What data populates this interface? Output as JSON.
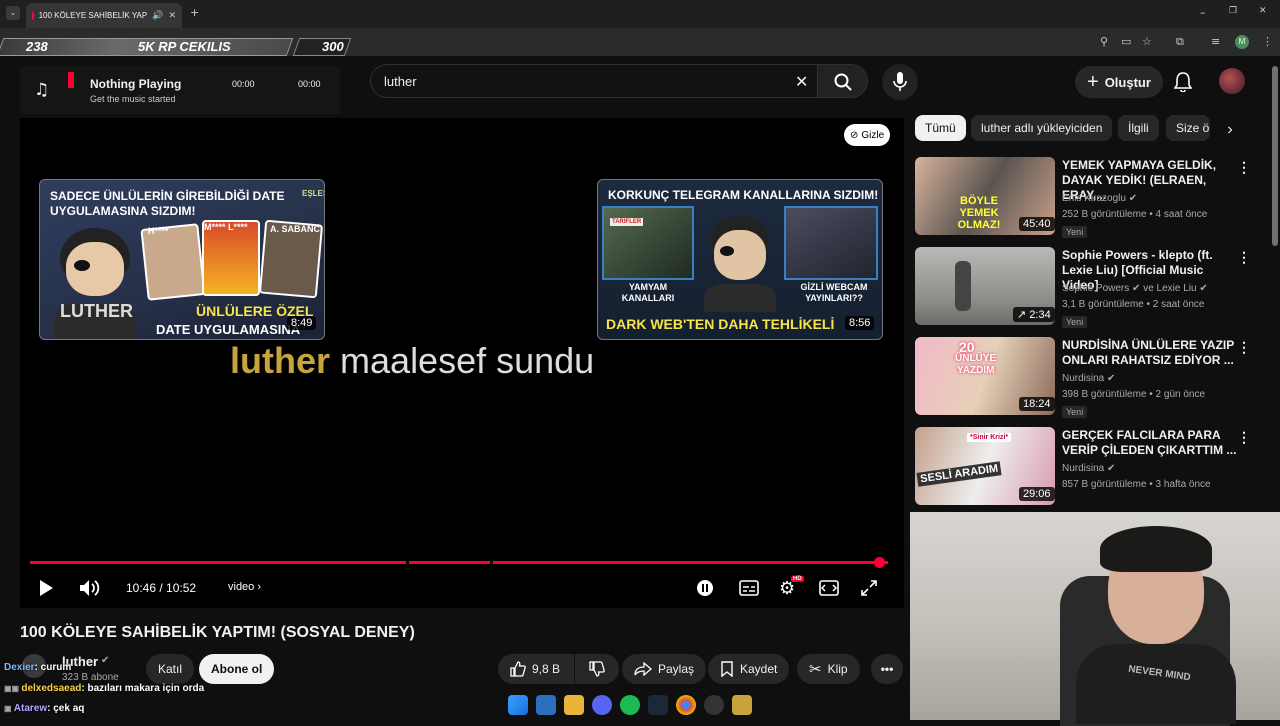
{
  "browser": {
    "tab_title": "100 KÖLEYE SAHİBELİK YAP",
    "new_tab": "+",
    "win_min": "–",
    "win_max": "❐",
    "win_close": "✕"
  },
  "overlay": {
    "left": "238",
    "center": "5K RP CEKILIS",
    "right": "300"
  },
  "music": {
    "title": "Nothing Playing",
    "subtitle": "Get the music started",
    "time_current": "00:00",
    "time_total": "00:00"
  },
  "search": {
    "value": "luther"
  },
  "header": {
    "create_label": "Oluştur"
  },
  "player": {
    "hide_label": "Gizle",
    "endscreen_text_a": "luther",
    "endscreen_text_b": "maalesef sundu",
    "card1": {
      "title_line1": "SADECE ÜNLÜLERİN GİREBİLDİĞİ DATE",
      "title_line2": "UYGULAMASINA SIZDIM!",
      "tag": "EŞLEŞTİN!",
      "name1": "H****",
      "name2": "M**** L****",
      "name3": "A. SABANCI",
      "brand": "LUTHER",
      "bottom1": "ÜNLÜLERE ÖZEL",
      "bottom2": "DATE UYGULAMASINA SIZDIM!",
      "duration": "8:49"
    },
    "card2": {
      "title": "KORKUNÇ TELEGRAM KANALLARINA SIZDIM!",
      "panel1": "TARİFLER",
      "label1": "YAMYAM KANALLARI",
      "label2": "GİZLİ WEBCAM YAYINLARI??",
      "bottom": "DARK WEB'TEN DAHA TEHLİKELİ",
      "duration": "8:56"
    },
    "time": "10:46 / 10:52",
    "chapter": "video",
    "progress_fraction": 0.99,
    "hd_badge": "HD"
  },
  "video": {
    "title": "100 KÖLEYE SAHİBELİK YAPTIM! (SOSYAL DENEY)",
    "channel": "luther",
    "subscribers": "323 B abone",
    "join_label": "Katıl",
    "subscribe_label": "Abone ol",
    "likes": "9,8 B",
    "share_label": "Paylaş",
    "save_label": "Kaydet",
    "clip_label": "Klip"
  },
  "chips": [
    "Tümü",
    "luther adlı yükleyiciden",
    "İlgili",
    "Size ö"
  ],
  "recommendations": [
    {
      "title": "YEMEK YAPMAYA GELDİK, DAYAK YEDİK! (ELRAEN, ERAY,...",
      "channel": "Enis Kirazoglu",
      "meta": "252 B görüntüleme • 4 saat önce",
      "badge": "Yeni",
      "duration": "45:40",
      "thumb_text": "BÖYLE YEMEK OLMAZ!"
    },
    {
      "title": "Sophie Powers - klepto (ft. Lexie Liu) [Official Music Video]",
      "channel": "Sophie Powers",
      "channel2": "ve Lexie Liu",
      "meta": "3,1 B görüntüleme • 2 saat önce",
      "badge": "Yeni",
      "duration": "2:34"
    },
    {
      "title": "NURDİSİNA ÜNLÜLERE YAZIP ONLARI RAHATSIZ EDİYOR ...",
      "channel": "Nurdisina",
      "meta": "398 B görüntüleme • 2 gün önce",
      "badge": "Yeni",
      "duration": "18:24",
      "thumb_text_1": "20",
      "thumb_text_2": "ÜNLÜYE",
      "thumb_text_3": "YAZDIM"
    },
    {
      "title": "GERÇEK FALCILARA PARA VERİP ÇİLEDEN ÇIKARTTIM ...",
      "channel": "Nurdisina",
      "meta": "857 B görüntüleme • 3 hafta önce",
      "duration": "29:06",
      "thumb_text": "SESLİ ARADIM",
      "thumb_tag": "*Sinir Krizi*"
    }
  ],
  "chat": [
    {
      "user": "Dexier",
      "message": ": curum",
      "color": "#7ab8ff"
    },
    {
      "user": "delxedsaead",
      "message": ": bazıları makara için orda",
      "color": "#ffd24a"
    },
    {
      "user": "Atarew",
      "message": ": çek aq",
      "color": "#b6a4ff"
    }
  ],
  "webcam": {
    "shirt_text": "NEVER MIND"
  },
  "colors": {
    "accent": "#ff0033",
    "gold": "#c8a23a",
    "bg": "#0f0f0f"
  }
}
